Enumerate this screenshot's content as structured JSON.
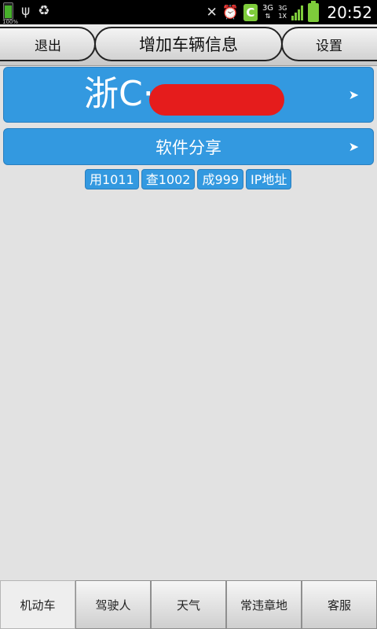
{
  "status_bar": {
    "battery_small_percent": "100%",
    "network_type_1": "3G",
    "network_type_2": "3G",
    "network_type_2_sub": "1X",
    "time": "20:52",
    "icons": [
      "battery-icon",
      "usb-icon",
      "recycle-icon",
      "mute-icon",
      "alarm-icon",
      "c-app-icon",
      "signal-icon",
      "battery-icon"
    ]
  },
  "header": {
    "exit_label": "退出",
    "title": "增加车辆信息",
    "settings_label": "设置"
  },
  "vehicle": {
    "plate_prefix": "浙C·"
  },
  "share": {
    "label": "软件分享"
  },
  "badges": [
    "用1011",
    "查1002",
    "成999",
    "IP地址"
  ],
  "tabs": [
    {
      "label": "机动车",
      "active": true
    },
    {
      "label": "驾驶人",
      "active": false
    },
    {
      "label": "天气",
      "active": false
    },
    {
      "label": "常违章地",
      "active": false
    },
    {
      "label": "客服",
      "active": false
    }
  ],
  "colors": {
    "accent_blue": "#3399e0",
    "redaction": "#e51c1c",
    "status_green": "#7ecb3b"
  }
}
